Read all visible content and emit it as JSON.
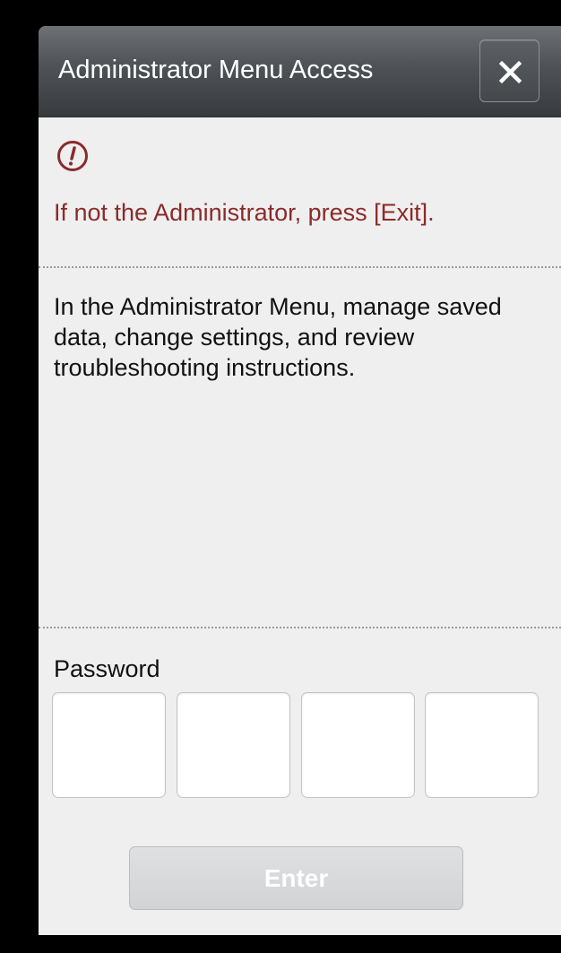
{
  "dialog": {
    "title": "Administrator Menu Access",
    "close_icon": "close-icon",
    "warning_icon": "exclamation-circle-icon",
    "warning_text": "If not the Administrator, press [Exit].",
    "description": "In the Administrator Menu, manage saved data, change settings, and review troubleshooting instructions.",
    "password_label": "Password",
    "password_digits": [
      "",
      "",
      "",
      ""
    ],
    "enter_label": "Enter",
    "enter_enabled": false
  },
  "colors": {
    "titlebar": "#4e5256",
    "body_background": "#efefef",
    "warning_text": "#8b2a2a",
    "enter_button_disabled": "#d6d7d9"
  }
}
